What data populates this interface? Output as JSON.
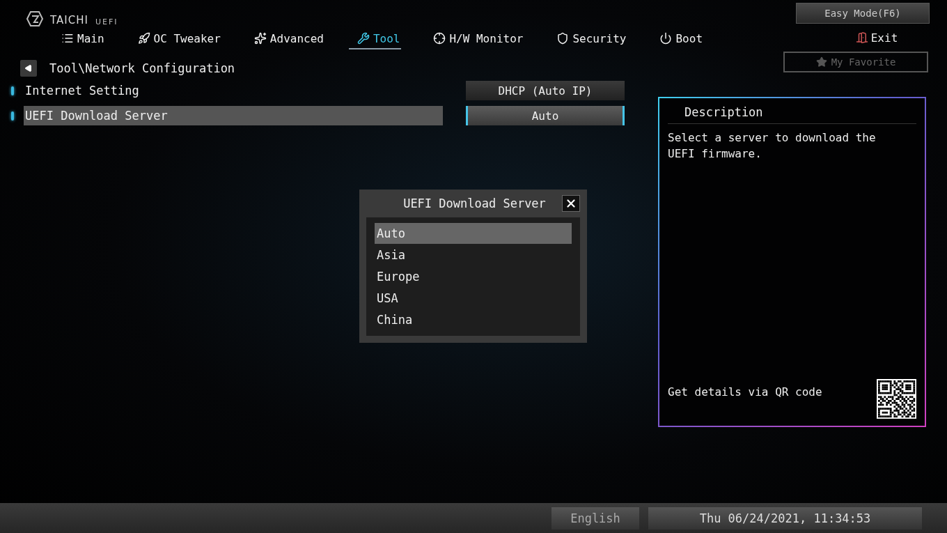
{
  "logo": {
    "brand": "TAICHI",
    "suffix": "UEFI"
  },
  "tabs": [
    {
      "label": "Main",
      "selected": false
    },
    {
      "label": "OC Tweaker",
      "selected": false
    },
    {
      "label": "Advanced",
      "selected": false
    },
    {
      "label": "Tool",
      "selected": true
    },
    {
      "label": "H/W Monitor",
      "selected": false
    },
    {
      "label": "Security",
      "selected": false
    },
    {
      "label": "Boot",
      "selected": false
    }
  ],
  "top_buttons": {
    "easy_mode": "Easy Mode(F6)",
    "exit": "Exit",
    "favorite": "My Favorite"
  },
  "breadcrumb": "Tool\\Network Configuration",
  "settings": [
    {
      "label": "Internet Setting",
      "value": "DHCP (Auto IP)",
      "selected": false
    },
    {
      "label": "UEFI Download Server",
      "value": "Auto",
      "selected": true
    }
  ],
  "dialog": {
    "title": "UEFI Download Server",
    "options": [
      {
        "label": "Auto",
        "selected": true
      },
      {
        "label": "Asia",
        "selected": false
      },
      {
        "label": "Europe",
        "selected": false
      },
      {
        "label": "USA",
        "selected": false
      },
      {
        "label": "China",
        "selected": false
      }
    ]
  },
  "description": {
    "title": "Description",
    "text": "Select a server to download the UEFI firmware.",
    "qr_hint": "Get details via QR code"
  },
  "status_bar": {
    "language": "English",
    "datetime": "Thu 06/24/2021, 11:34:53"
  }
}
